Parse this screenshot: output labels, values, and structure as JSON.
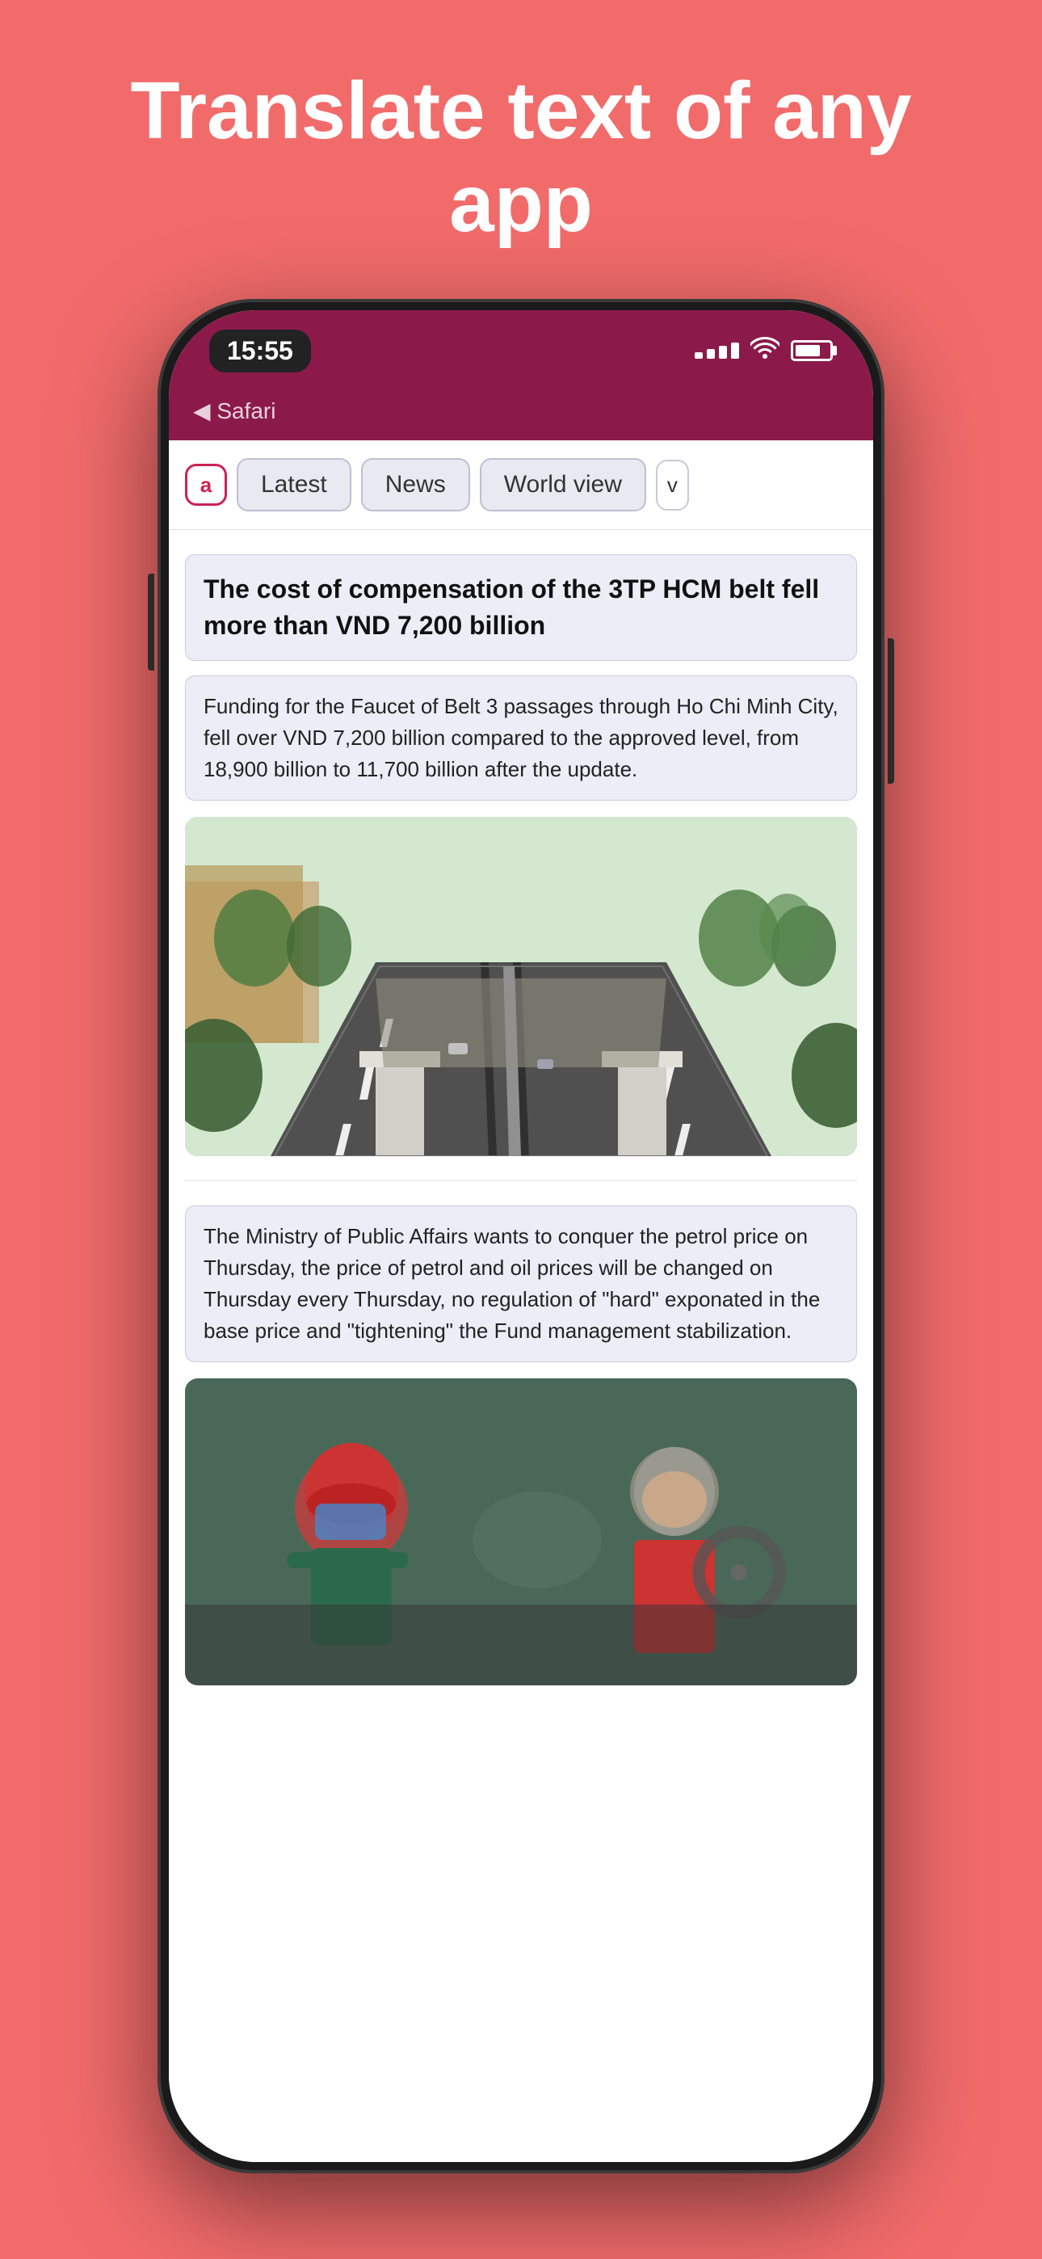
{
  "hero": {
    "title": "Translate text of any app"
  },
  "phone": {
    "outer_status": {
      "time": "15:55"
    },
    "inner_status": {
      "time": "15:55"
    },
    "safari_back": "Safari",
    "tabs": [
      {
        "label": "a",
        "type": "icon"
      },
      {
        "label": "Latest",
        "type": "tab"
      },
      {
        "label": "News",
        "type": "tab",
        "active": true
      },
      {
        "label": "World view",
        "type": "tab"
      },
      {
        "label": "v",
        "type": "more"
      }
    ],
    "articles": [
      {
        "title": "The cost of compensation of the 3TP HCM belt fell more than VND 7,200 billion",
        "summary": "Funding for the Faucet of Belt 3 passages through Ho Chi Minh City, fell over VND 7,200 billion compared to the approved level, from 18,900 billion to 11,700 billion after the update.",
        "has_road_image": true
      },
      {
        "title": "",
        "summary": "The Ministry of Public Affairs wants to conquer the petrol price on Thursday, the price of petrol and oil prices will be changed on Thursday every Thursday, no regulation of \"hard\" exponated in the base price and \"tightening\" the Fund management stabilization.",
        "has_petrol_image": true
      }
    ]
  }
}
